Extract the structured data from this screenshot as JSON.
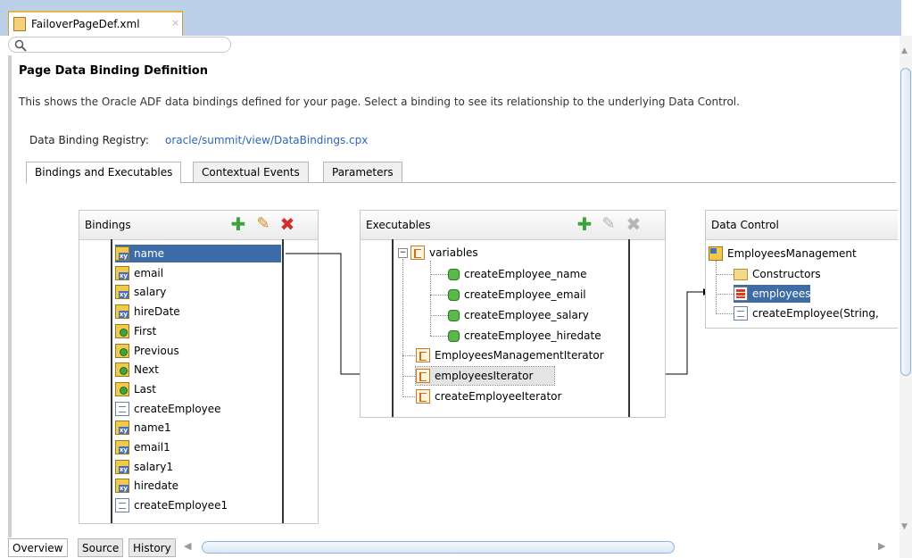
{
  "file_tab": {
    "label": "FailoverPageDef.xml",
    "close": "×"
  },
  "header": {
    "title": "Page Data Binding Definition",
    "description": "This shows the Oracle ADF data bindings defined for your page. Select a binding to see its relationship to the underlying Data Control.",
    "registry_label": "Data Binding Registry:",
    "registry_link": "oracle/summit/view/DataBindings.cpx"
  },
  "section_tabs": [
    "Bindings and Executables",
    "Contextual Events",
    "Parameters"
  ],
  "bindings": {
    "title": "Bindings",
    "selected": "name",
    "items": [
      {
        "label": "name",
        "icon": "attribute-binding-icon"
      },
      {
        "label": "email",
        "icon": "attribute-binding-icon"
      },
      {
        "label": "salary",
        "icon": "attribute-binding-icon"
      },
      {
        "label": "hireDate",
        "icon": "attribute-binding-icon"
      },
      {
        "label": "First",
        "icon": "action-binding-icon"
      },
      {
        "label": "Previous",
        "icon": "action-binding-icon"
      },
      {
        "label": "Next",
        "icon": "action-binding-icon"
      },
      {
        "label": "Last",
        "icon": "action-binding-icon"
      },
      {
        "label": "createEmployee",
        "icon": "method-binding-icon"
      },
      {
        "label": "name1",
        "icon": "attribute-binding-icon"
      },
      {
        "label": "email1",
        "icon": "attribute-binding-icon"
      },
      {
        "label": "salary1",
        "icon": "attribute-binding-icon"
      },
      {
        "label": "hiredate",
        "icon": "attribute-binding-icon"
      },
      {
        "label": "createEmployee1",
        "icon": "method-binding-icon"
      }
    ]
  },
  "executables": {
    "title": "Executables",
    "root": "variables",
    "root_toggle": "−",
    "variables": [
      "createEmployee_name",
      "createEmployee_email",
      "createEmployee_salary",
      "createEmployee_hiredate"
    ],
    "iterators": [
      "EmployeesManagementIterator",
      "employeesIterator",
      "createEmployeeIterator"
    ],
    "selected": "employeesIterator"
  },
  "data_control": {
    "title": "Data Control",
    "root": "EmployeesManagement",
    "children": [
      "Constructors",
      "employees",
      "createEmployee(String,"
    ],
    "selected": "employees"
  },
  "bottom_tabs": [
    "Overview",
    "Source",
    "History"
  ],
  "colors": {
    "selection": "#3d6ca6",
    "link": "#2e66b5",
    "add": "#3aa33a",
    "delete": "#d32f2f"
  }
}
